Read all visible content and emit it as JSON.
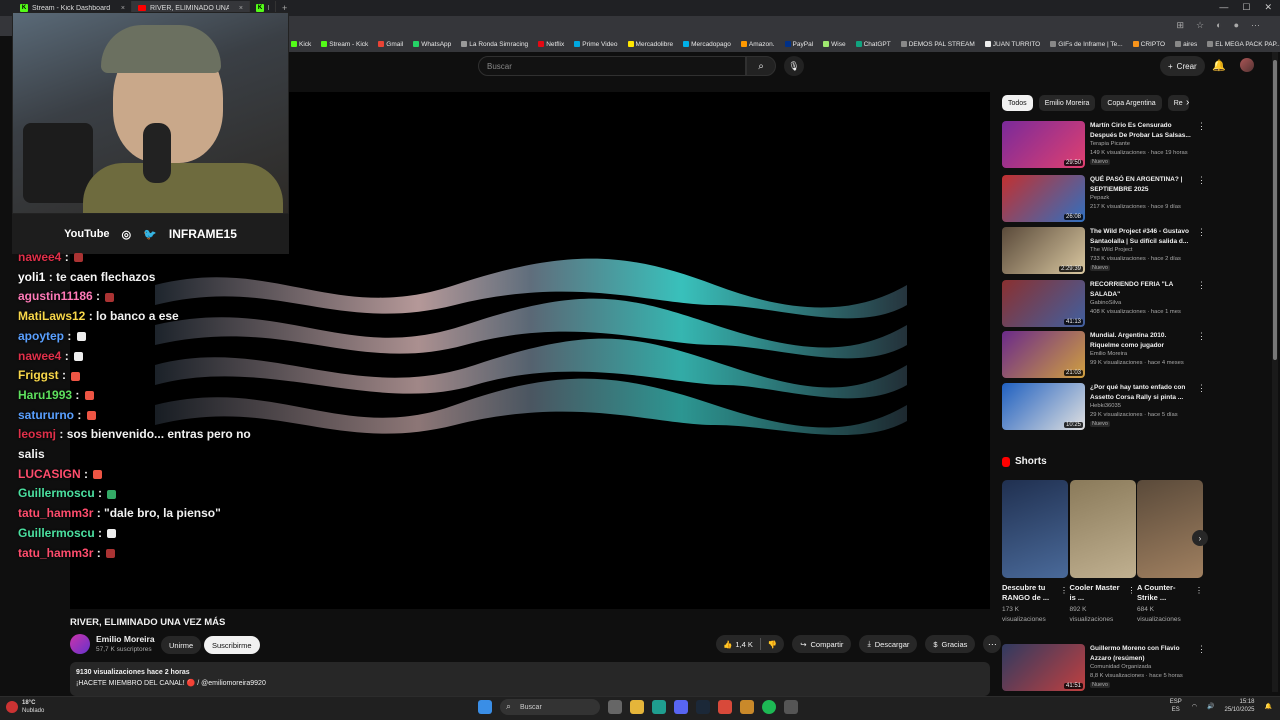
{
  "browser": {
    "tabs": [
      {
        "label": "Stream - Kick Dashboard",
        "kind": "kick"
      },
      {
        "label": "RIVER, ELIMINADO UNA VEZ MÁ",
        "kind": "youtube"
      },
      {
        "label": "Kick",
        "kind": "kick"
      }
    ],
    "bookmarks": [
      "Kick",
      "Stream - Kick",
      "Gmail",
      "WhatsApp",
      "La Ronda Simracing",
      "Netflix",
      "Prime Video",
      "Mercadolibre",
      "Mercadopago",
      "Amazon.",
      "PayPal",
      "Wise",
      "ChatGPT",
      "DEMOS PAL STREAM",
      "JUAN TURRITO",
      "GIFs de Inframe | Te...",
      "CRIPTO",
      "aires",
      "EL MEGA PACK PAP..."
    ]
  },
  "youtube": {
    "search_placeholder": "Buscar",
    "crear_label": "Crear"
  },
  "overlay": {
    "social_youtube": "YouTube",
    "handle": "INFRAME15",
    "chat": [
      {
        "user": "nawee4",
        "msg": "",
        "color": "#e0304a",
        "emote": "#a33"
      },
      {
        "user": "yoli1",
        "msg": "te caen flechazos",
        "color": "#ffffff",
        "emote": ""
      },
      {
        "user": "agustin11186",
        "msg": "",
        "color": "#ff7ab8",
        "emote": "#a33"
      },
      {
        "user": "MatiLaws12",
        "msg": "lo banco a ese",
        "color": "#f8d74a",
        "emote": ""
      },
      {
        "user": "apoytep",
        "msg": "",
        "color": "#5aa0ff",
        "emote": "#eee"
      },
      {
        "user": "nawee4",
        "msg": "",
        "color": "#e0304a",
        "emote": "#eee"
      },
      {
        "user": "Friggst",
        "msg": "",
        "color": "#f8d74a",
        "emote": "#e54"
      },
      {
        "user": "Haru1993",
        "msg": "",
        "color": "#5ee05e",
        "emote": "#e54"
      },
      {
        "user": "satururno",
        "msg": "",
        "color": "#5aa0ff",
        "emote": "#e54"
      },
      {
        "user": "leosmj",
        "msg": "sos bienvenido... entras pero no salis",
        "color": "#e0304a",
        "emote": ""
      },
      {
        "user": "LUCASIGN",
        "msg": "",
        "color": "#ff4d6d",
        "emote": "#e54"
      },
      {
        "user": "Guillermoscu",
        "msg": "",
        "color": "#4be0a0",
        "emote": "#3a6"
      },
      {
        "user": "tatu_hamm3r",
        "msg": "\"dale bro, la pienso\"",
        "color": "#ff4d6d",
        "emote": ""
      },
      {
        "user": "Guillermoscu",
        "msg": "",
        "color": "#4be0a0",
        "emote": "#eee"
      },
      {
        "user": "tatu_hamm3r",
        "msg": "",
        "color": "#ff4d6d",
        "emote": "#a33"
      }
    ]
  },
  "video": {
    "title": "RIVER, ELIMINADO UNA VEZ MÁS",
    "channel": "Emilio Moreira",
    "subscribers": "57,7 K suscriptores",
    "join_label": "Unirme",
    "subscribe_label": "Suscribirme",
    "likes": "1,4 K",
    "share_label": "Compartir",
    "download_label": "Descargar",
    "thanks_label": "Gracias",
    "views_line": "9130 visualizaciones  hace 2 horas",
    "desc_line": "¡HACETE MIEMBRO DEL CANAL!  🔴 / @emiliomoreira9920"
  },
  "sidebar": {
    "chips": [
      "Todos",
      "Emilio Moreira",
      "Copa Argentina",
      "Re"
    ],
    "recommendations": [
      {
        "title": "Martín Cirio Es Censurado Después De Probar Las Salsas...",
        "channel": "Terapia Picante",
        "meta": "149 K visualizaciones · hace 19 horas",
        "badge": "Nuevo",
        "duration": "29:50",
        "c1": "#7a2a9a",
        "c2": "#e04070"
      },
      {
        "title": "QUÉ PASÓ EN ARGENTINA? | SEPTIEMBRE 2025",
        "channel": "Pepazk",
        "meta": "217 K visualizaciones · hace 9 días",
        "badge": "",
        "duration": "26:08",
        "c1": "#c23030",
        "c2": "#3070c0"
      },
      {
        "title": "The Wild Project #346 - Gustavo Santaolalla | Su difícil salida d...",
        "channel": "The Wild Project",
        "meta": "733 K visualizaciones · hace 2 días",
        "badge": "Nuevo",
        "duration": "2:29:39",
        "c1": "#5a4a3a",
        "c2": "#d9c7a0"
      },
      {
        "title": "RECORRIENDO FERIA \"LA SALADA\"",
        "channel": "GabinoSilva",
        "meta": "408 K visualizaciones · hace 1 mes",
        "badge": "",
        "duration": "41:13",
        "c1": "#8a3030",
        "c2": "#4060a0"
      },
      {
        "title": "Mundial. Argentina 2010. Riquelme como jugador",
        "channel": "Emilio Moreira",
        "meta": "99 K visualizaciones · hace 4 meses",
        "badge": "",
        "duration": "21:03",
        "c1": "#6a2a8a",
        "c2": "#d0a040"
      },
      {
        "title": "¿Por qué hay tanto enfado con Assetto Corsa Rally si pinta ...",
        "channel": "Hebki36035",
        "meta": "29 K visualizaciones · hace 5 días",
        "badge": "Nuevo",
        "duration": "10:25",
        "c1": "#2060c0",
        "c2": "#e0e0e0"
      }
    ],
    "shorts_title": "Shorts",
    "shorts": [
      {
        "title": "Descubre tu RANGO de ...",
        "views": "173 K visualizaciones",
        "c1": "#203050",
        "c2": "#4a6a9a"
      },
      {
        "title": "Cooler Master is ...",
        "views": "892 K visualizaciones",
        "c1": "#8a7a5a",
        "c2": "#c0b090"
      },
      {
        "title": "A Counter-Strike ...",
        "views": "684 K visualizaciones",
        "c1": "#5a4a3a",
        "c2": "#a08060"
      }
    ],
    "last": {
      "title": "Guillermo Moreno con Flavio Azzaro (resúmen)",
      "channel": "Comunidad Organizada",
      "meta": "8,8 K visualizaciones · hace 5 horas",
      "badge": "Nuevo",
      "duration": "41:51",
      "c1": "#303a60",
      "c2": "#c04040"
    }
  },
  "taskbar": {
    "temp": "18°C",
    "weather": "Nublado",
    "search": "Buscar",
    "lang1": "ESP",
    "lang2": "ES",
    "time": "15:18",
    "date": "25/10/2025"
  }
}
